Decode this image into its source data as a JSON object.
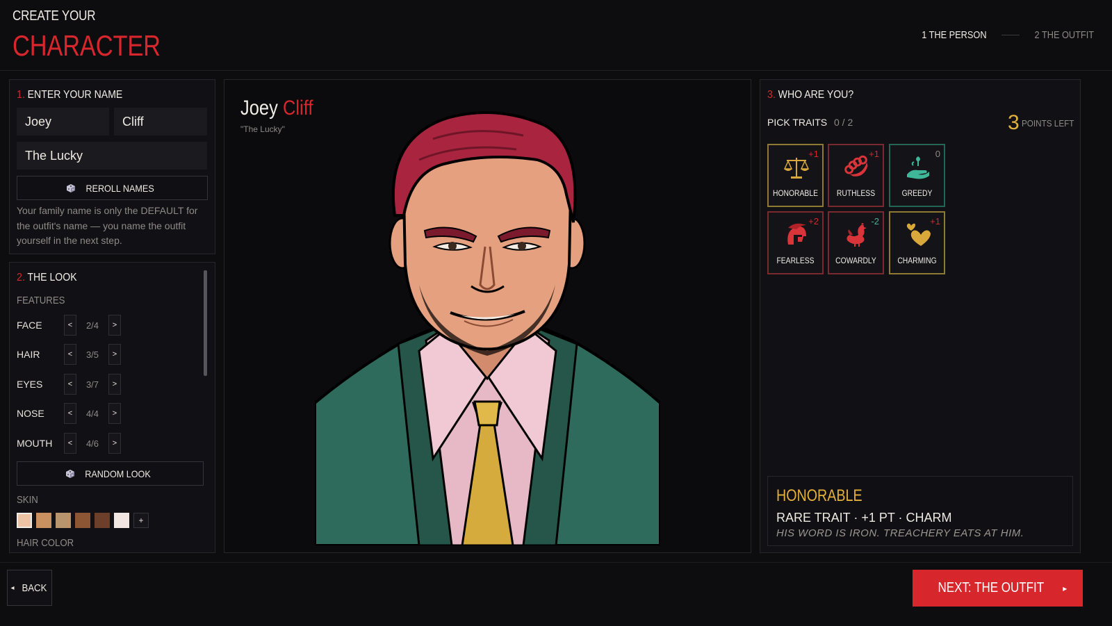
{
  "header": {
    "pre_title": "CREATE YOUR",
    "title": "CHARACTER",
    "steps": [
      {
        "label": "1 THE PERSON",
        "active": true
      },
      {
        "label": "2 THE OUTFIT",
        "active": false
      }
    ]
  },
  "name_section": {
    "num": "1.",
    "title": "ENTER YOUR NAME",
    "first_name": "Joey",
    "last_name": "Cliff",
    "nickname": "The Lucky",
    "reroll_label": "REROLL NAMES",
    "note": "Your family name is only the DEFAULT for the outfit's name — you name the outfit yourself in the next step."
  },
  "look_section": {
    "num": "2.",
    "title": "THE LOOK",
    "features_label": "FEATURES",
    "features": [
      {
        "name": "FACE",
        "value": "2/4"
      },
      {
        "name": "HAIR",
        "value": "3/5"
      },
      {
        "name": "EYES",
        "value": "3/7"
      },
      {
        "name": "NOSE",
        "value": "4/4"
      },
      {
        "name": "MOUTH",
        "value": "4/6"
      }
    ],
    "prev_symbol": "<",
    "next_symbol": ">",
    "random_label": "RANDOM LOOK",
    "skin_label": "SKIN",
    "skin_swatches": [
      "#eec3a3",
      "#c9915f",
      "#b9956e",
      "#8c5533",
      "#6b3f2a",
      "#f2e6e2"
    ],
    "add_symbol": "+",
    "hair_color_label": "HAIR COLOR"
  },
  "portrait": {
    "first": "Joey",
    "last": "Cliff",
    "nickname": "\"The Lucky\"",
    "colors": {
      "hair": "#a8243f",
      "suit": "#2f6b5c",
      "shirt": "#e7b9c6",
      "tie": "#d4ab3c",
      "skin": "#e4a07f"
    }
  },
  "traits_section": {
    "num": "3.",
    "title": "WHO ARE YOU?",
    "pick_label": "PICK TRAITS",
    "pick_count": "0 / 2",
    "points": "3",
    "points_label": "POINTS LEFT",
    "traits": [
      {
        "name": "HONORABLE",
        "cost": "+1",
        "icon": "scales-icon",
        "border": "#8f7a34",
        "cost_color": "#d8262d"
      },
      {
        "name": "RUTHLESS",
        "cost": "+1",
        "icon": "brass-knuckles-icon",
        "border": "#7a2a2e",
        "cost_color": "#d8262d"
      },
      {
        "name": "GREEDY",
        "cost": "0",
        "icon": "money-hand-icon",
        "border": "#246655",
        "cost_color": "#8e8b86"
      },
      {
        "name": "FEARLESS",
        "cost": "+2",
        "icon": "helmet-icon",
        "border": "#7a2a2e",
        "cost_color": "#d8262d"
      },
      {
        "name": "COWARDLY",
        "cost": "-2",
        "icon": "chicken-icon",
        "border": "#7a2a2e",
        "cost_color": "#3fb89a"
      },
      {
        "name": "CHARMING",
        "cost": "+1",
        "icon": "hearts-icon",
        "border": "#8f7a34",
        "cost_color": "#d8262d"
      }
    ],
    "detail": {
      "name": "HONORABLE",
      "meta": "RARE TRAIT · +1 PT · CHARM",
      "flavor": "HIS WORD IS IRON. TREACHERY EATS AT HIM."
    }
  },
  "footer": {
    "back_label": "BACK",
    "back_arrow": "◂",
    "next_label": "NEXT: THE OUTFIT",
    "next_arrow": "▸"
  },
  "colors": {
    "accent": "#d8262d",
    "gold": "#e3b13a",
    "teal": "#3fb89a",
    "bg": "#0d0d10"
  }
}
